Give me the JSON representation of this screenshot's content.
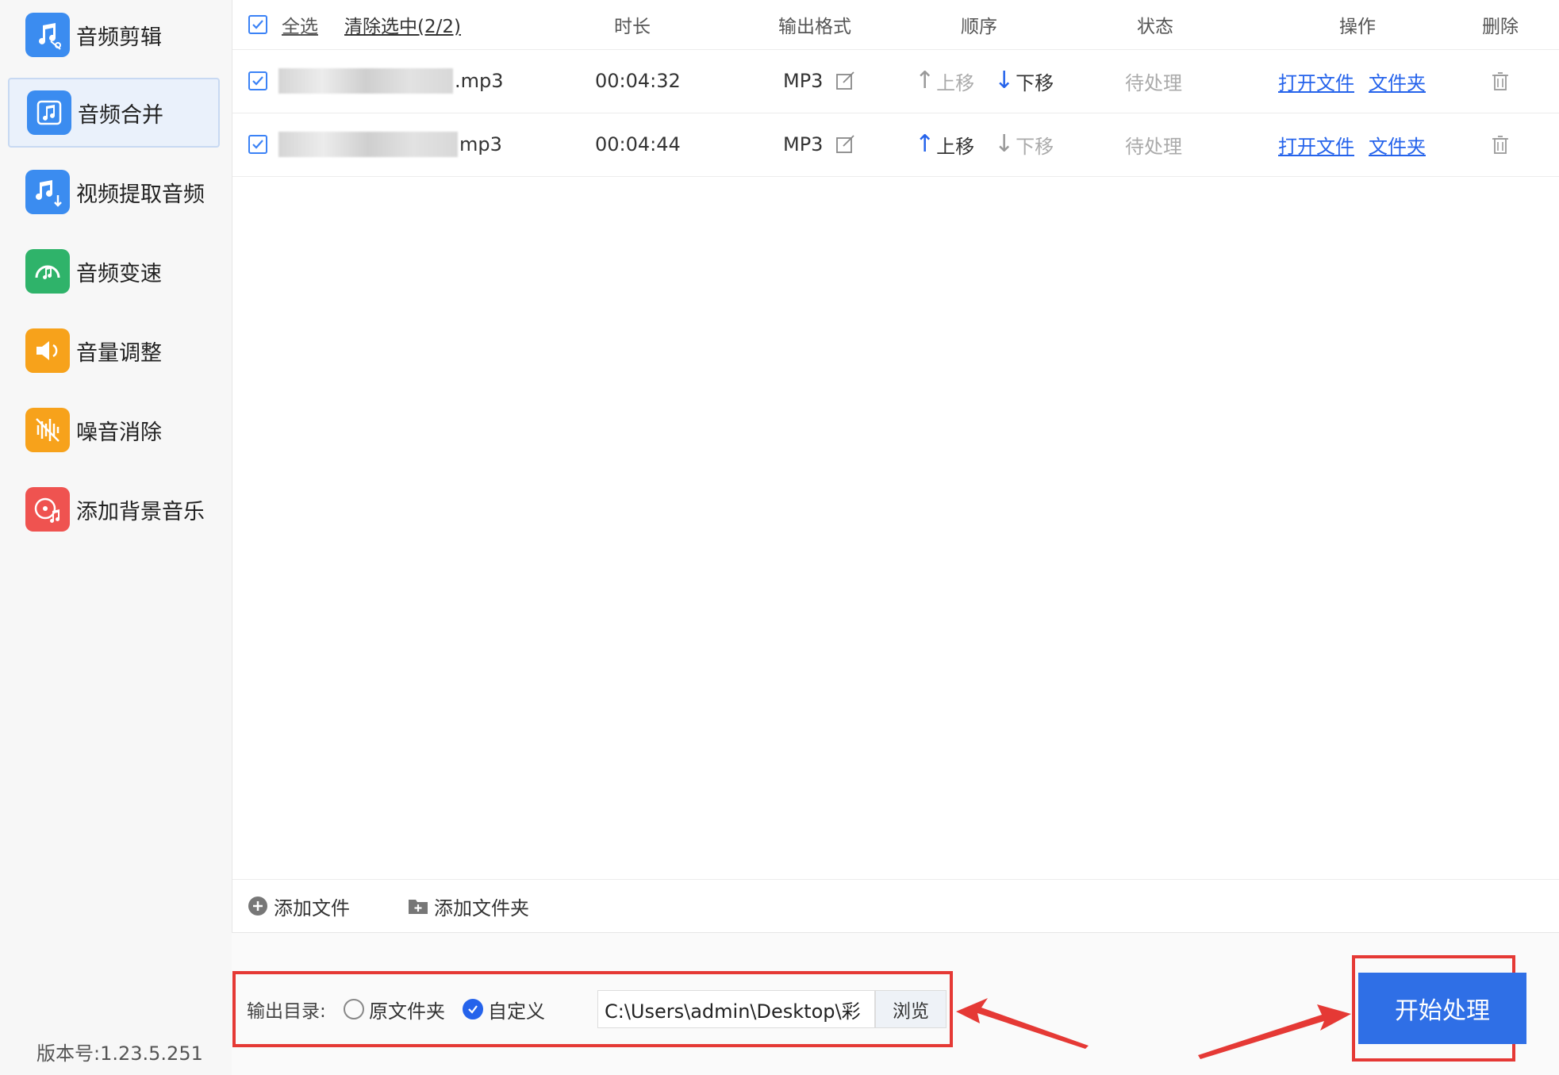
{
  "sidebar": {
    "items": [
      {
        "label": "音频剪辑",
        "icon": "music-scissors-icon",
        "color": "#3b8cf0",
        "active": false
      },
      {
        "label": "音频合并",
        "icon": "music-note-icon",
        "color": "#3b8cf0",
        "active": true
      },
      {
        "label": "视频提取音频",
        "icon": "music-download-icon",
        "color": "#3b8cf0",
        "active": false
      },
      {
        "label": "音频变速",
        "icon": "speedometer-icon",
        "color": "#2fb36a",
        "active": false
      },
      {
        "label": "音量调整",
        "icon": "speaker-icon",
        "color": "#f7a21b",
        "active": false
      },
      {
        "label": "噪音消除",
        "icon": "noise-wave-icon",
        "color": "#f7a21b",
        "active": false
      },
      {
        "label": "添加背景音乐",
        "icon": "disc-music-icon",
        "color": "#ef5350",
        "active": false
      }
    ],
    "version": "版本号:1.23.5.251"
  },
  "table": {
    "select_all": "全选",
    "clear_selected": "清除选中(2/2)",
    "columns": {
      "duration": "时长",
      "format": "输出格式",
      "order": "顺序",
      "status": "状态",
      "actions": "操作",
      "delete": "删除"
    },
    "rows": [
      {
        "name_suffix": ".mp3",
        "duration": "00:04:32",
        "format": "MP3",
        "move_up": "上移",
        "move_down": "下移",
        "status": "待处理",
        "open_file": "打开文件",
        "open_folder": "文件夹"
      },
      {
        "name_suffix": "mp3",
        "duration": "00:04:44",
        "format": "MP3",
        "move_up": "上移",
        "move_down": "下移",
        "status": "待处理",
        "open_file": "打开文件",
        "open_folder": "文件夹"
      }
    ]
  },
  "addbar": {
    "add_file": "添加文件",
    "add_folder": "添加文件夹"
  },
  "output": {
    "label": "输出目录:",
    "option_original": "原文件夹",
    "option_custom": "自定义",
    "selected": "自定义",
    "path": "C:\\Users\\admin\\Desktop\\彩",
    "browse": "浏览"
  },
  "start_button": "开始处理",
  "colors": {
    "accent": "#2f6fe6",
    "highlight_red": "#e53935",
    "link_blue": "#2563eb"
  }
}
